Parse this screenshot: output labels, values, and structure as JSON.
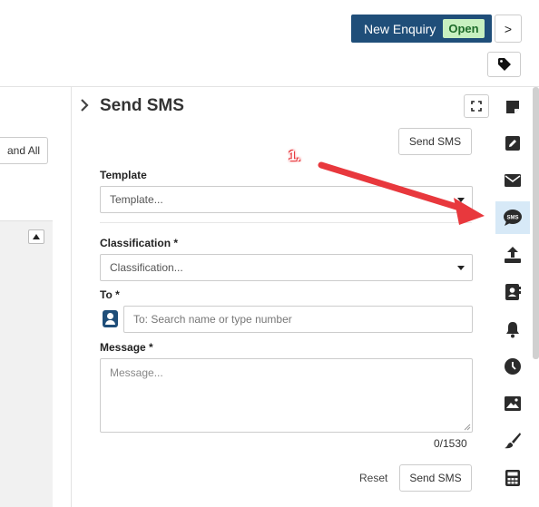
{
  "header": {
    "enquiry_label": "New Enquiry",
    "status_badge": "Open",
    "nav_next_glyph": ">"
  },
  "left_panel": {
    "expand_all_partial": "and All",
    "scroll_up_glyph": "▲"
  },
  "sms_panel": {
    "title": "Send SMS",
    "send_sms_top_label": "Send SMS",
    "template": {
      "label": "Template",
      "selected": "Template..."
    },
    "classification": {
      "label": "Classification *",
      "selected": "Classification..."
    },
    "to": {
      "label": "To *",
      "placeholder": "To: Search name or type number"
    },
    "message": {
      "label": "Message *",
      "placeholder": "Message...",
      "char_count": "0/1530"
    },
    "reset_label": "Reset",
    "send_sms_bottom_label": "Send SMS"
  },
  "annotation": {
    "step_label": "1."
  },
  "rail": {
    "items": [
      {
        "icon": "note-icon"
      },
      {
        "icon": "edit-icon"
      },
      {
        "icon": "envelope-icon"
      },
      {
        "icon": "sms-icon",
        "active": true,
        "text": "SMS"
      },
      {
        "icon": "upload-icon"
      },
      {
        "icon": "contact-card-icon"
      },
      {
        "icon": "bell-icon"
      },
      {
        "icon": "clock-icon"
      },
      {
        "icon": "image-icon"
      },
      {
        "icon": "brush-icon"
      },
      {
        "icon": "calculator-icon"
      }
    ]
  },
  "colors": {
    "brand": "#1f4e79",
    "badge_bg": "#c8f0c0",
    "active_rail_bg": "#d7e9f7",
    "annotation_red": "#e8383d"
  }
}
